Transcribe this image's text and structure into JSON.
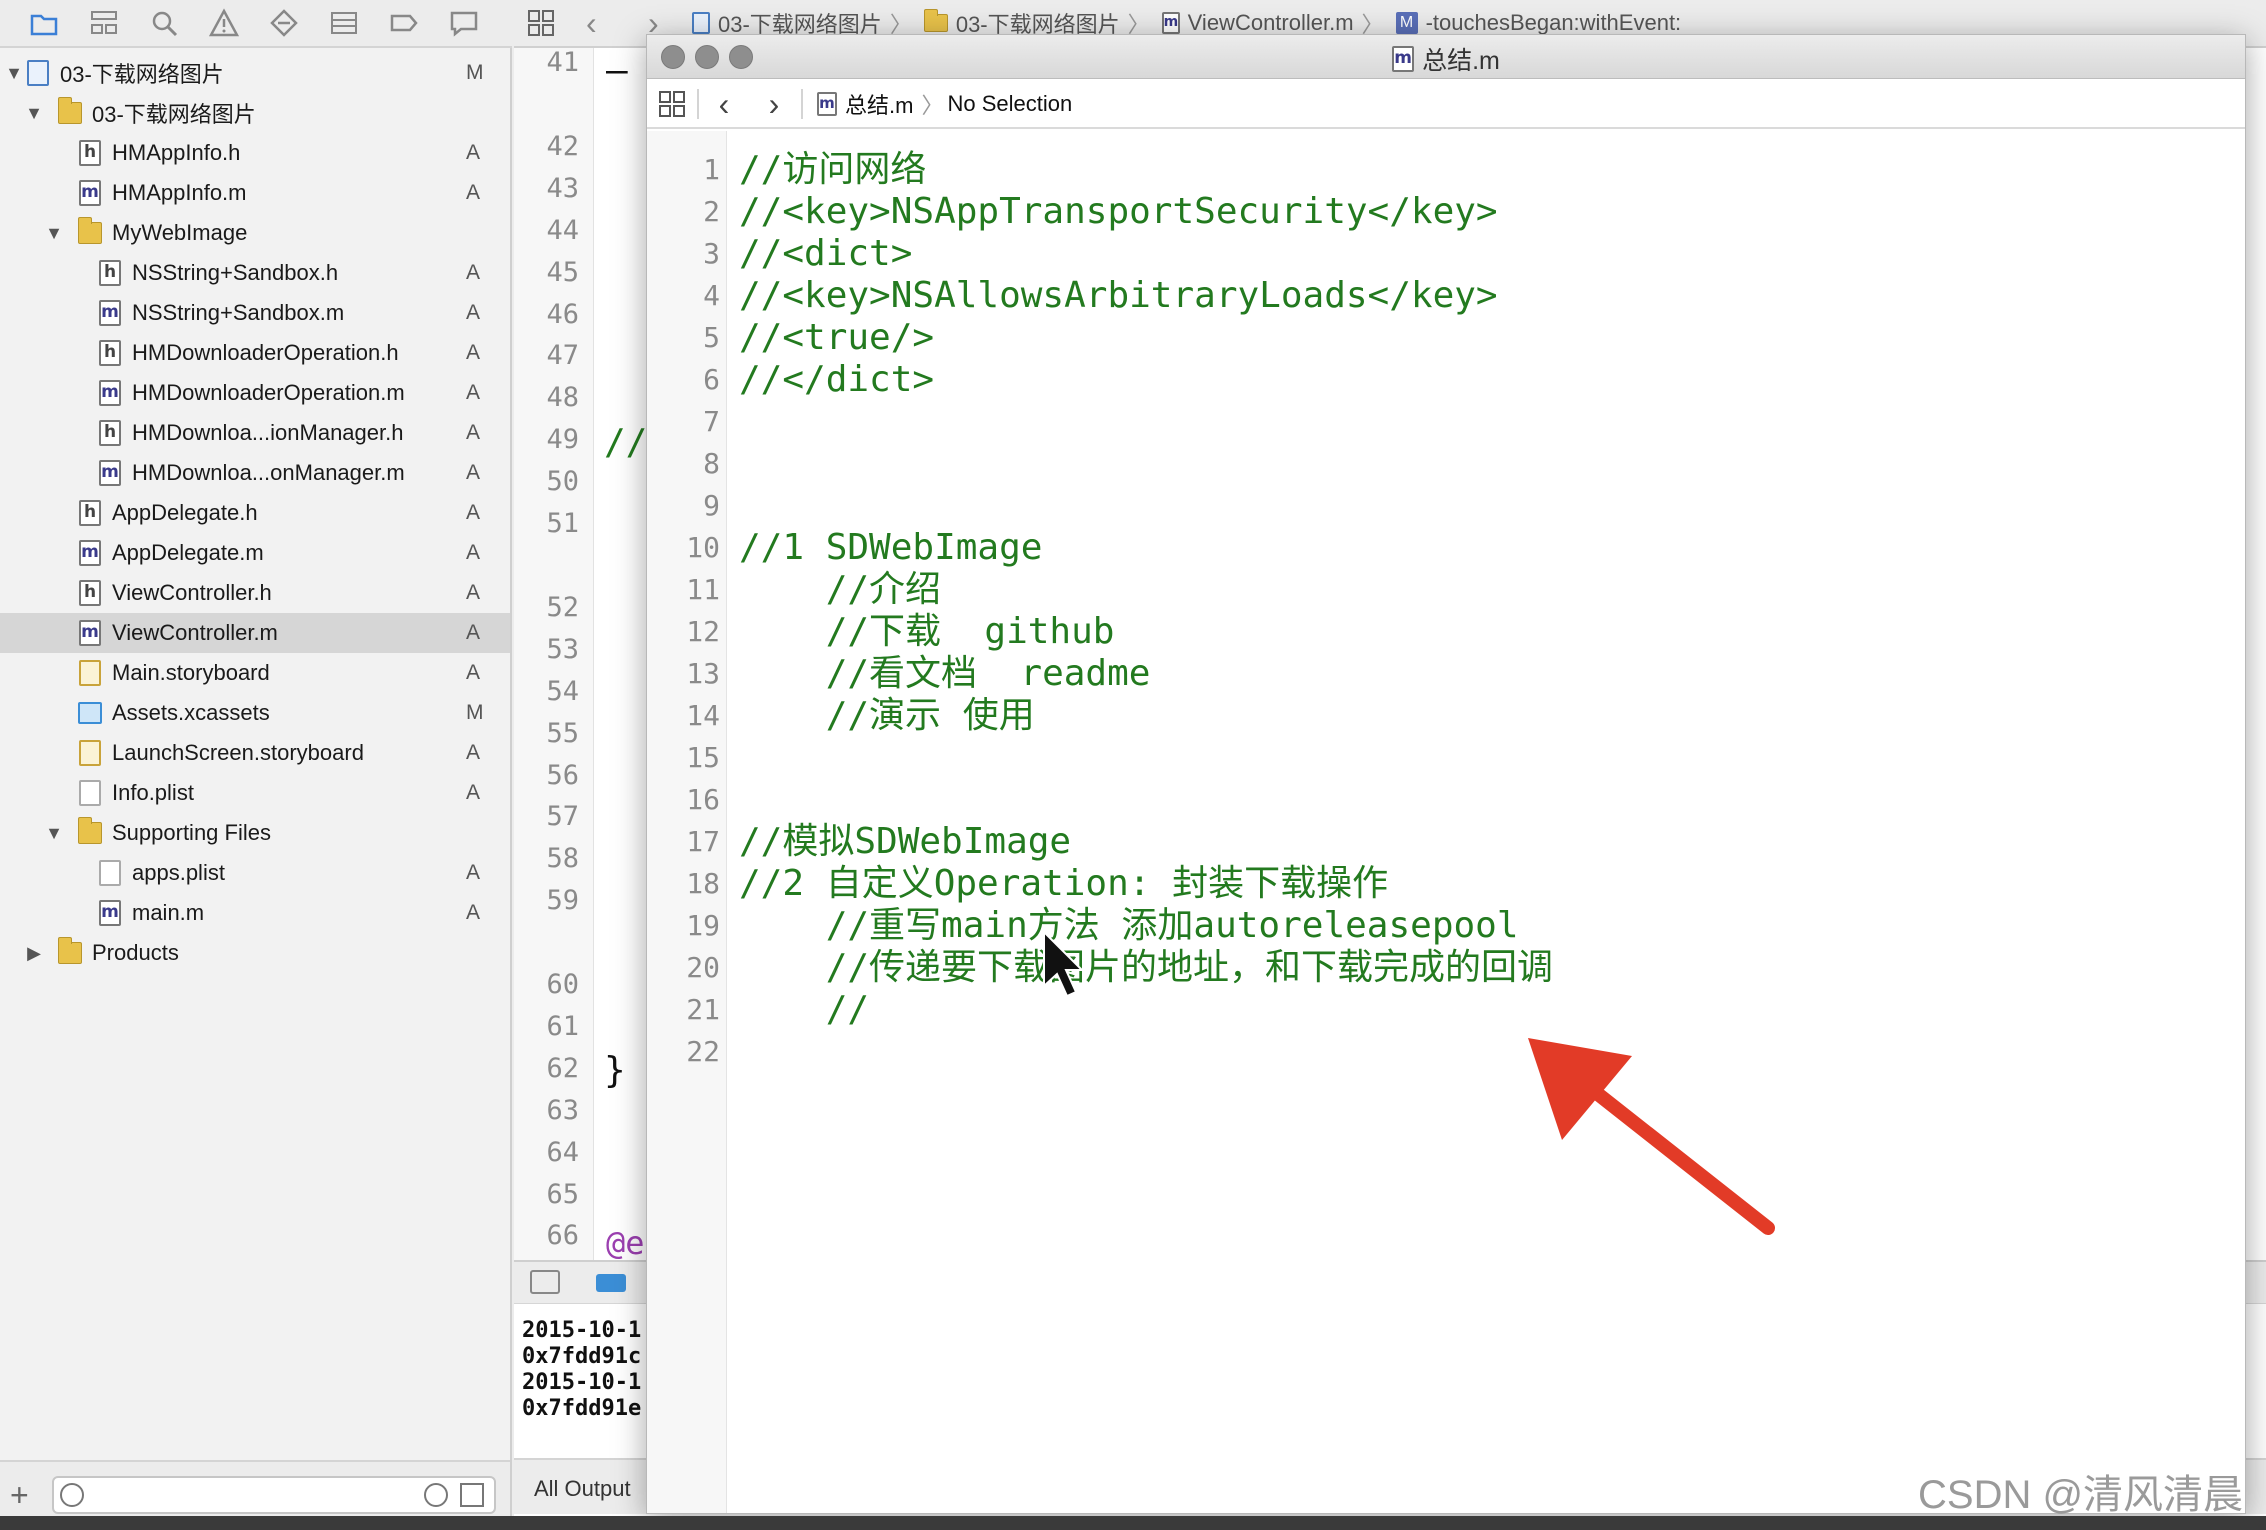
{
  "jumpbar": {
    "crumbs": [
      "03-下载网络图片",
      "03-下载网络图片",
      "ViewController.m",
      "-touchesBegan:withEvent:"
    ],
    "method_badge": "M"
  },
  "navigator": {
    "items": [
      {
        "label": "03-下载网络图片",
        "badge": "M",
        "icon": "project-icon",
        "level": 0,
        "disclosure": "▼"
      },
      {
        "label": "03-下载网络图片",
        "badge": "",
        "icon": "folder-icon",
        "level": 1,
        "disclosure": "▼"
      },
      {
        "label": "HMAppInfo.h",
        "badge": "A",
        "icon": "h",
        "level": 2,
        "disclosure": ""
      },
      {
        "label": "HMAppInfo.m",
        "badge": "A",
        "icon": "m",
        "level": 2,
        "disclosure": ""
      },
      {
        "label": "MyWebImage",
        "badge": "",
        "icon": "folder-icon",
        "level": 2,
        "disclosure": "▼"
      },
      {
        "label": "NSString+Sandbox.h",
        "badge": "A",
        "icon": "h",
        "level": 3,
        "disclosure": ""
      },
      {
        "label": "NSString+Sandbox.m",
        "badge": "A",
        "icon": "m",
        "level": 3,
        "disclosure": ""
      },
      {
        "label": "HMDownloaderOperation.h",
        "badge": "A",
        "icon": "h",
        "level": 3,
        "disclosure": ""
      },
      {
        "label": "HMDownloaderOperation.m",
        "badge": "A",
        "icon": "m",
        "level": 3,
        "disclosure": ""
      },
      {
        "label": "HMDownloa...ionManager.h",
        "badge": "A",
        "icon": "h",
        "level": 3,
        "disclosure": ""
      },
      {
        "label": "HMDownloa...onManager.m",
        "badge": "A",
        "icon": "m",
        "level": 3,
        "disclosure": ""
      },
      {
        "label": "AppDelegate.h",
        "badge": "A",
        "icon": "h",
        "level": 2,
        "disclosure": ""
      },
      {
        "label": "AppDelegate.m",
        "badge": "A",
        "icon": "m",
        "level": 2,
        "disclosure": ""
      },
      {
        "label": "ViewController.h",
        "badge": "A",
        "icon": "h",
        "level": 2,
        "disclosure": ""
      },
      {
        "label": "ViewController.m",
        "badge": "A",
        "icon": "m",
        "level": 2,
        "disclosure": "",
        "selected": true
      },
      {
        "label": "Main.storyboard",
        "badge": "A",
        "icon": "storyboard-icon",
        "level": 2,
        "disclosure": ""
      },
      {
        "label": "Assets.xcassets",
        "badge": "M",
        "icon": "assets-icon",
        "level": 2,
        "disclosure": ""
      },
      {
        "label": "LaunchScreen.storyboard",
        "badge": "A",
        "icon": "storyboard-icon",
        "level": 2,
        "disclosure": ""
      },
      {
        "label": "Info.plist",
        "badge": "A",
        "icon": "plist-icon",
        "level": 2,
        "disclosure": ""
      },
      {
        "label": "Supporting Files",
        "badge": "",
        "icon": "folder-icon",
        "level": 2,
        "disclosure": "▼"
      },
      {
        "label": "apps.plist",
        "badge": "A",
        "icon": "plist-icon",
        "level": 3,
        "disclosure": ""
      },
      {
        "label": "main.m",
        "badge": "A",
        "icon": "m",
        "level": 3,
        "disclosure": ""
      },
      {
        "label": "Products",
        "badge": "",
        "icon": "folder-icon",
        "level": 1,
        "disclosure": "▶"
      }
    ]
  },
  "bg_editor": {
    "line_numbers": [
      "41",
      "42",
      "43",
      "44",
      "45",
      "46",
      "47",
      "48",
      "49",
      "50",
      "51",
      "52",
      "53",
      "54",
      "55",
      "56",
      "57",
      "58",
      "59",
      "60",
      "61",
      "62",
      "63",
      "64",
      "65",
      "66"
    ],
    "visible_code": {
      "l41": "–",
      "l49": "//",
      "l62": "}",
      "l66": "@e"
    }
  },
  "console": {
    "lines": [
      "2015-10-1",
      "0x7fdd91c",
      "2015-10-1",
      "0x7fdd91e"
    ],
    "filter_label": "All Output"
  },
  "window": {
    "title": "总结.m",
    "file_icon_letter": "m",
    "jumpbar_file": "总结.m",
    "jumpbar_selection": "No Selection",
    "lines": [
      "//访问网络",
      "//<key>NSAppTransportSecurity</key>",
      "//<dict>",
      "//<key>NSAllowsArbitraryLoads</key>",
      "//<true/>",
      "//</dict>",
      "",
      "",
      "",
      "//1 SDWebImage",
      "    //介绍",
      "    //下载  github",
      "    //看文档  readme",
      "    //演示 使用",
      "",
      "",
      "//模拟SDWebImage",
      "//2 自定义Operation: 封装下载操作",
      "    //重写main方法 添加autoreleasepool",
      "    //传递要下载图片的地址，和下载完成的回调",
      "    //",
      ""
    ]
  },
  "watermark": "CSDN @清风清晨",
  "colors": {
    "comment": "#237a1f",
    "arrow": "#e23b27",
    "selection": "#d6d6d6"
  }
}
